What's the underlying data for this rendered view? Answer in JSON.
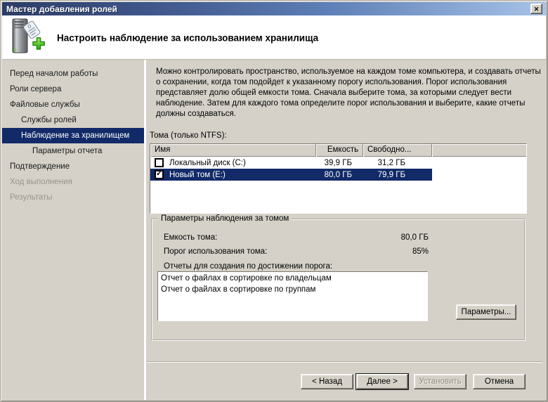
{
  "window": {
    "title": "Мастер добавления ролей"
  },
  "icons": {
    "close": "✕",
    "check": "✓",
    "header_icon": "server-with-tag-and-green-plus"
  },
  "header": {
    "title": "Настроить наблюдение за использованием хранилища"
  },
  "sidebar": {
    "items": [
      {
        "label": "Перед началом работы",
        "indent": 0,
        "state": "normal"
      },
      {
        "label": "Роли сервера",
        "indent": 0,
        "state": "normal"
      },
      {
        "label": "Файловые службы",
        "indent": 0,
        "state": "normal"
      },
      {
        "label": "Службы ролей",
        "indent": 1,
        "state": "normal"
      },
      {
        "label": "Наблюдение за хранилищем",
        "indent": 1,
        "state": "selected"
      },
      {
        "label": "Параметры отчета",
        "indent": 2,
        "state": "normal"
      },
      {
        "label": "Подтверждение",
        "indent": 0,
        "state": "normal"
      },
      {
        "label": "Ход выполнения",
        "indent": 0,
        "state": "disabled"
      },
      {
        "label": "Результаты",
        "indent": 0,
        "state": "disabled"
      }
    ]
  },
  "main": {
    "description": "Можно контролировать пространство, используемое на каждом томе компьютера, и создавать отчеты о сохранении, когда том подойдет к указанному порогу использования.  Порог использования представляет долю общей емкости тома. Сначала выберите тома, за которыми следует вести наблюдение.  Затем для каждого тома определите порог использования и выберите, какие отчеты должны создаваться.",
    "volumes_label": "Тома (только NTFS):",
    "table": {
      "columns": [
        "Имя",
        "Емкость",
        "Свободно..."
      ],
      "rows": [
        {
          "checked": false,
          "name": "Локальный диск (C:)",
          "capacity": "39,9 ГБ",
          "free": "31,2 ГБ",
          "selected": false
        },
        {
          "checked": true,
          "name": "Новый том (E:)",
          "capacity": "80,0 ГБ",
          "free": "79,9 ГБ",
          "selected": true
        }
      ]
    },
    "group": {
      "title": "Параметры наблюдения за томом",
      "capacity_label": "Емкость тома:",
      "capacity_value": "80,0 ГБ",
      "threshold_label": "Порог использования тома:",
      "threshold_value": "85%",
      "reports_label": "Отчеты для создания по достижении порога:",
      "reports": [
        "Отчет о файлах в сортировке по владельцам",
        "Отчет о файлах в сортировке по группам"
      ],
      "options_button": "Параметры..."
    }
  },
  "footer": {
    "back": "< Назад",
    "next": "Далее >",
    "install": "Установить",
    "cancel": "Отмена"
  },
  "colors": {
    "dialog_bg": "#d5d1c9",
    "selection": "#122a68",
    "titlebar_gradient_start": "#2c3c66",
    "titlebar_gradient_end": "#a7c3e8",
    "disabled_text": "#98948c",
    "plus_green": "#3fb515"
  }
}
